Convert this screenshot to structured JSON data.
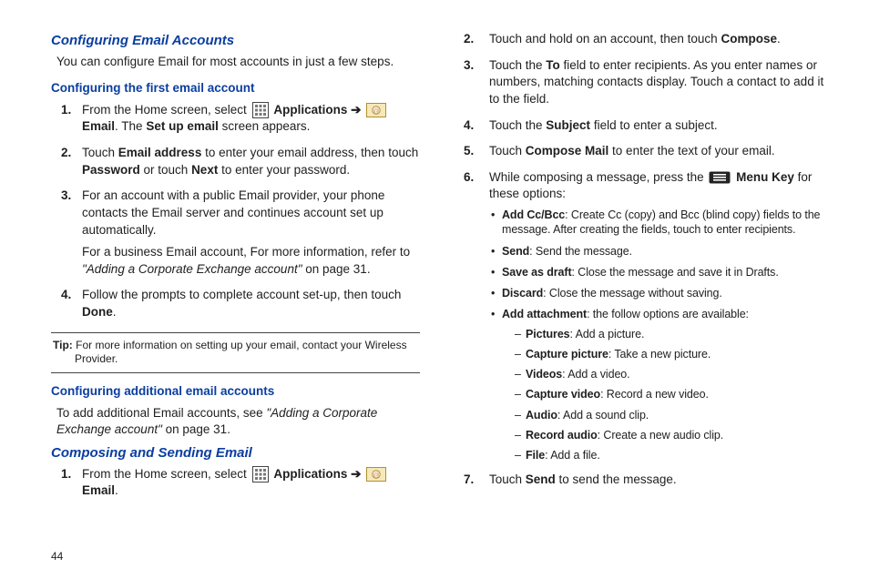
{
  "pageNumber": "44",
  "left": {
    "h1": "Configuring Email Accounts",
    "intro": "You can configure Email for most accounts in just a few steps.",
    "h2a": "Configuring the first email account",
    "steps1": {
      "s1_prefix": "From the Home screen, select ",
      "s1_app": "Applications",
      "s1_arrow": " ➔ ",
      "s1_email": "Email",
      "s1_suffix1": ". The ",
      "s1_setup": "Set up email",
      "s1_suffix2": " screen appears.",
      "s2_a": "Touch ",
      "s2_b": "Email address",
      "s2_c": " to enter your email address, then touch ",
      "s2_d": "Password",
      "s2_e": " or touch ",
      "s2_f": "Next",
      "s2_g": " to enter your password.",
      "s3_main": "For an account with a public Email provider, your phone contacts the Email server and continues account set up automatically.",
      "s3_extra_a": "For a business Email account, For more information, refer to ",
      "s3_extra_b": "\"Adding a Corporate Exchange account\"",
      "s3_extra_c": " on page 31.",
      "s4_a": "Follow the prompts to complete account set-up, then touch ",
      "s4_b": "Done",
      "s4_c": "."
    },
    "tip_label": "Tip:",
    "tip_first": " For more information on setting up your email, contact your Wireless",
    "tip_cont": "Provider.",
    "h2b": "Configuring additional email accounts",
    "addl_a": "To add additional Email accounts, see ",
    "addl_b": "\"Adding a Corporate Exchange account\"",
    "addl_c": " on page 31.",
    "h3": "Composing and Sending Email",
    "compose1_prefix": "From the Home screen, select ",
    "compose1_app": "Applications",
    "compose1_arrow": " ➔ ",
    "compose1_email": "Email",
    "compose1_suffix": "."
  },
  "right": {
    "s2_a": "Touch and hold on an account, then touch ",
    "s2_b": "Compose",
    "s2_c": ".",
    "s3_a": "Touch the ",
    "s3_b": "To",
    "s3_c": " field to enter recipients. As you enter names or numbers, matching contacts display. Touch a contact to add it to the field.",
    "s4_a": "Touch the ",
    "s4_b": "Subject",
    "s4_c": " field to enter a subject.",
    "s5_a": "Touch ",
    "s5_b": "Compose Mail",
    "s5_c": " to enter the text of your email.",
    "s6_a": "While composing a message, press the ",
    "s6_b": "Menu Key",
    "s6_c": " for these options:",
    "bul": {
      "b1a": "Add Cc/Bcc",
      "b1b": ": Create Cc (copy) and Bcc (blind copy) fields to the message. After creating the fields, touch to enter recipients.",
      "b2a": "Send",
      "b2b": ": Send the message.",
      "b3a": "Save as draft",
      "b3b": ": Close the message and save it in Drafts.",
      "b4a": "Discard",
      "b4b": ": Close the message without saving.",
      "b5a": "Add attachment",
      "b5b": ": the follow options are available:"
    },
    "dash": {
      "d1a": "Pictures",
      "d1b": ": Add a picture.",
      "d2a": "Capture picture",
      "d2b": ": Take a new picture.",
      "d3a": "Videos",
      "d3b": ": Add a video.",
      "d4a": "Capture video",
      "d4b": ": Record a new video.",
      "d5a": "Audio",
      "d5b": ": Add a sound clip.",
      "d6a": "Record audio",
      "d6b": ": Create a new audio clip.",
      "d7a": "File",
      "d7b": ": Add a file."
    },
    "s7_a": "Touch ",
    "s7_b": "Send",
    "s7_c": " to send the message."
  }
}
